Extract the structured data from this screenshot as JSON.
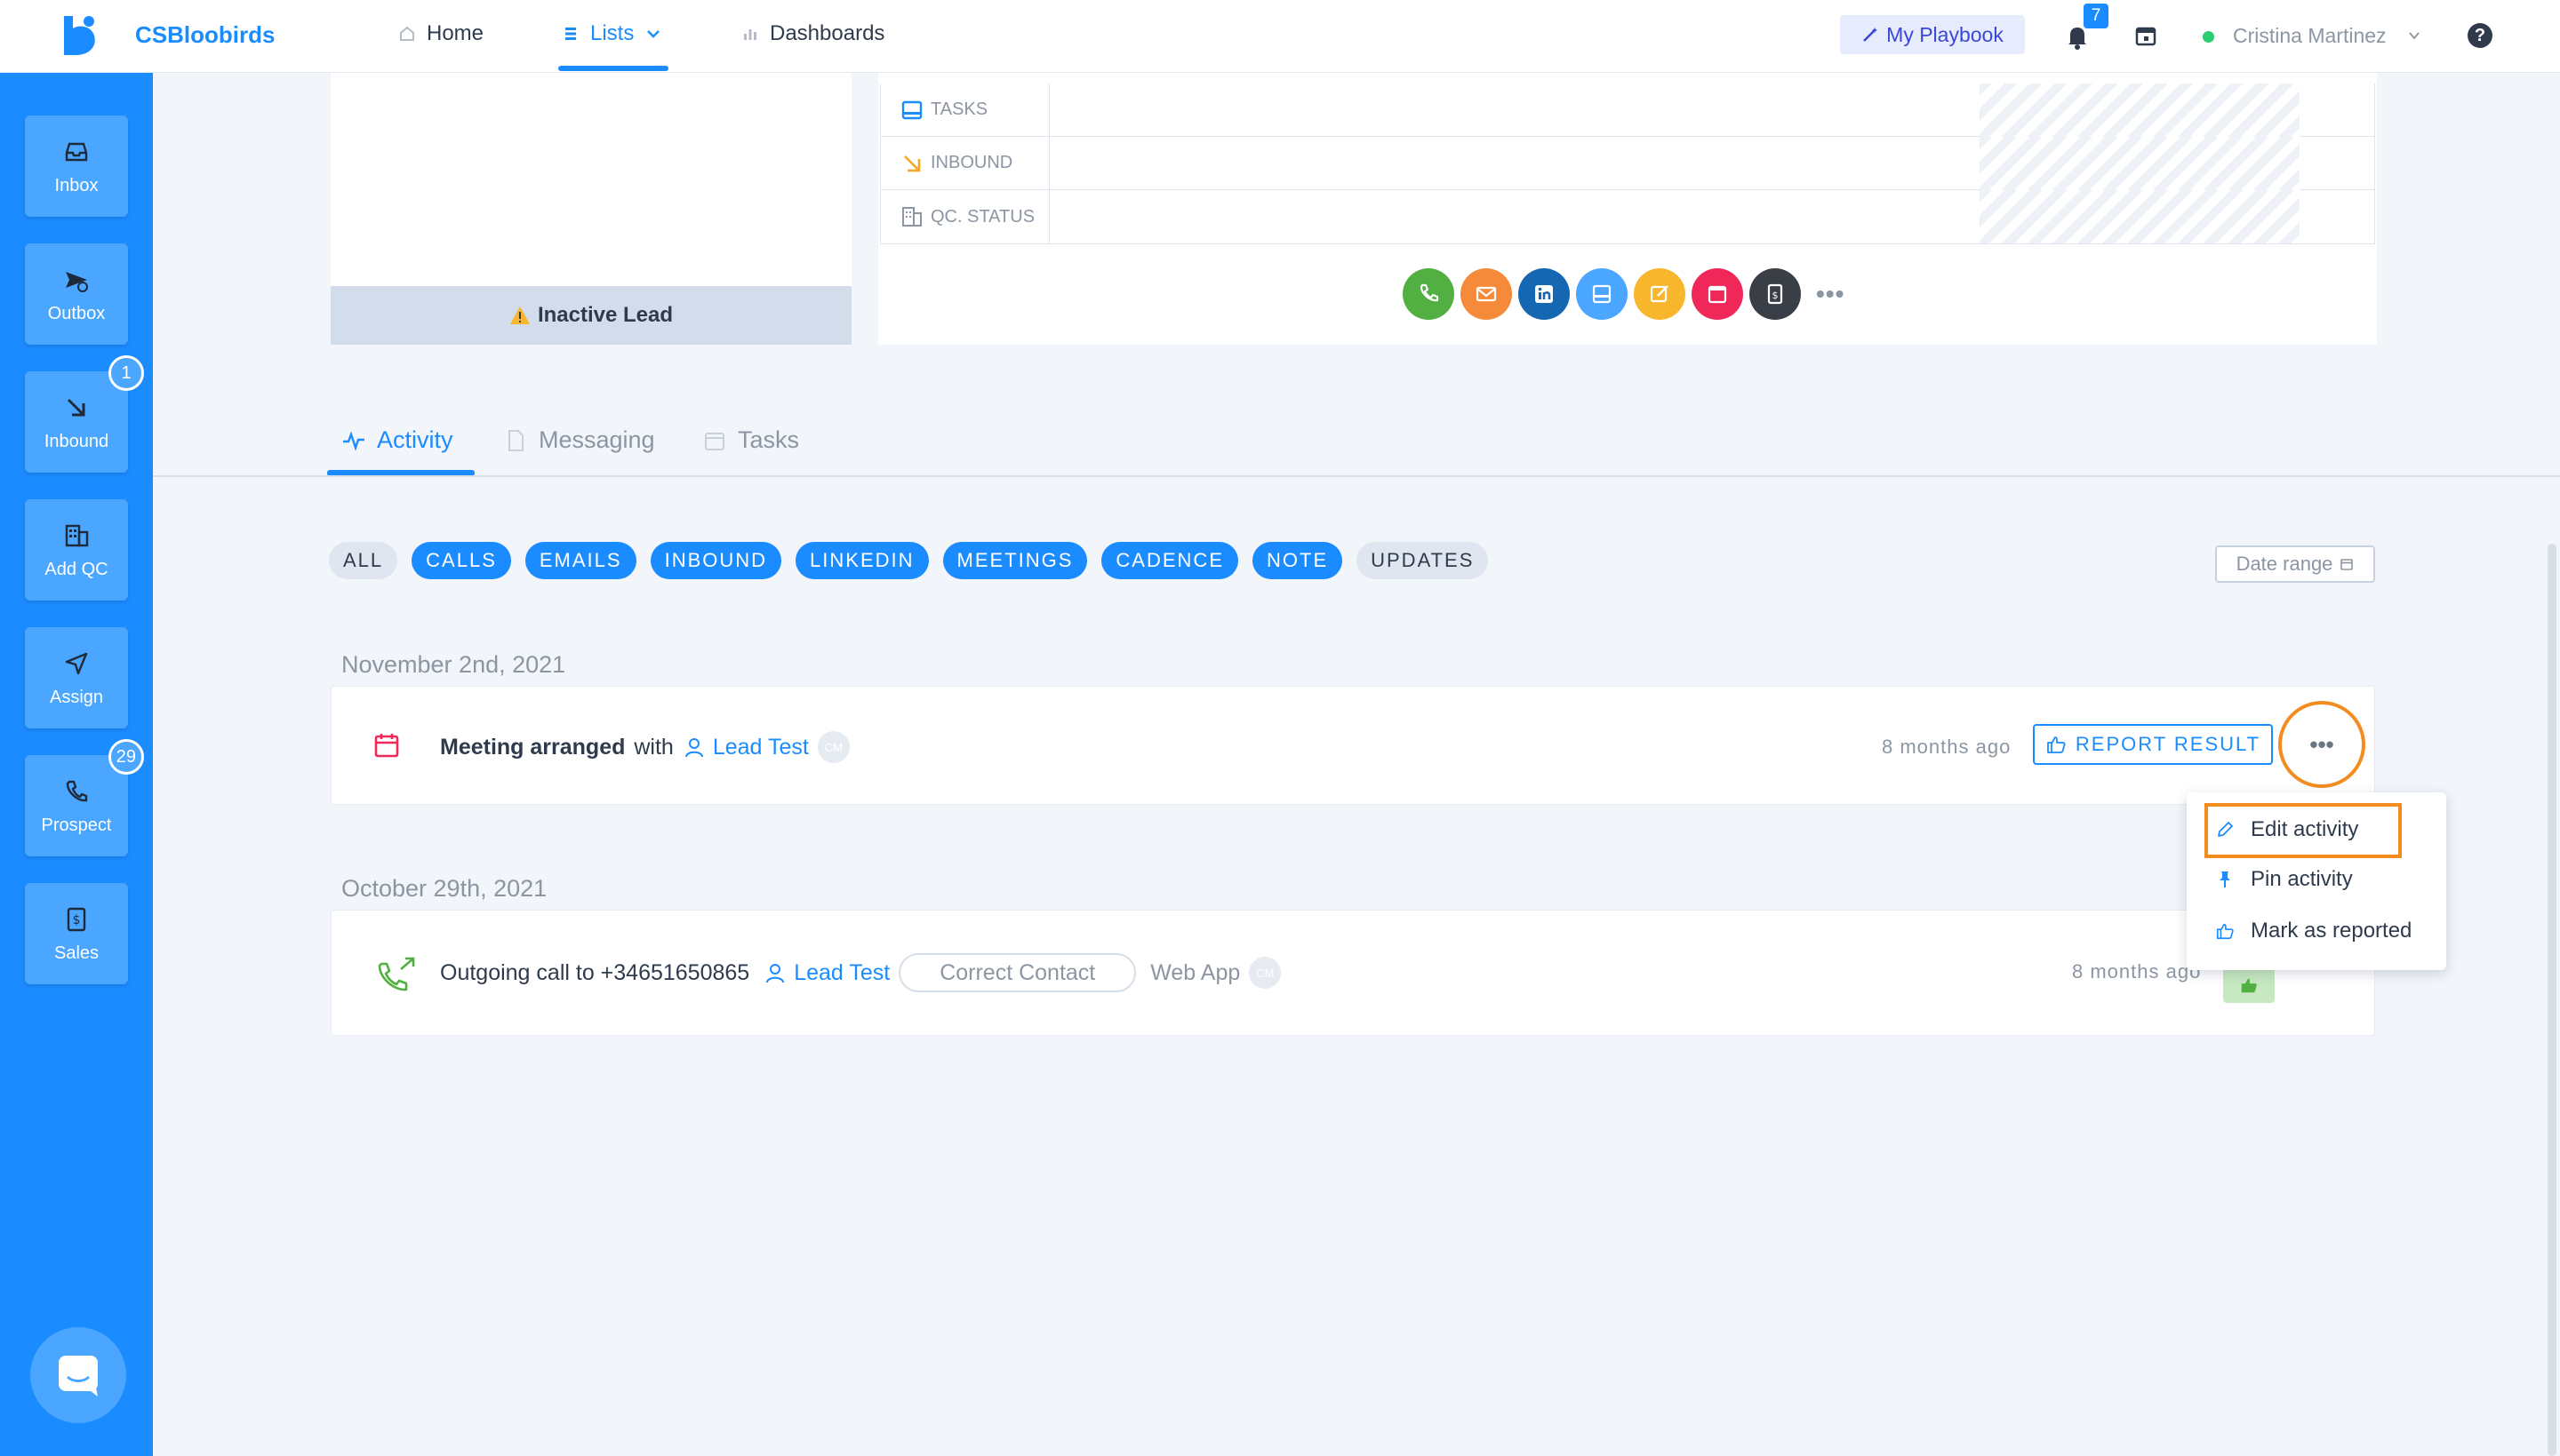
{
  "app": {
    "name": "CSBloobirds"
  },
  "nav": {
    "home": "Home",
    "lists": "Lists",
    "dashboards": "Dashboards"
  },
  "header": {
    "playbook": "My Playbook",
    "notifications_count": "7",
    "user_name": "Cristina Martinez",
    "help": "?"
  },
  "sidebar": {
    "items": [
      {
        "label": "Inbox",
        "badge": ""
      },
      {
        "label": "Outbox",
        "badge": ""
      },
      {
        "label": "Inbound",
        "badge": "1"
      },
      {
        "label": "Add QC",
        "badge": ""
      },
      {
        "label": "Assign",
        "badge": ""
      },
      {
        "label": "Prospect",
        "badge": "29"
      },
      {
        "label": "Sales",
        "badge": ""
      }
    ]
  },
  "lead_card": {
    "status": "Inactive Lead"
  },
  "info_table": {
    "rows": [
      {
        "label": "TASKS"
      },
      {
        "label": "INBOUND"
      },
      {
        "label": "QC. STATUS"
      }
    ]
  },
  "action_icons": [
    {
      "name": "phone-icon",
      "color": "#52b043"
    },
    {
      "name": "mail-icon",
      "color": "#f58b3a"
    },
    {
      "name": "linkedin-icon",
      "color": "#1667b1"
    },
    {
      "name": "inbox-icon",
      "color": "#4aa6ff"
    },
    {
      "name": "note-icon",
      "color": "#f8b62c"
    },
    {
      "name": "calendar-icon",
      "color": "#f0285a"
    },
    {
      "name": "invoice-icon",
      "color": "#3a3f47"
    }
  ],
  "tabs": {
    "activity": "Activity",
    "messaging": "Messaging",
    "tasks": "Tasks"
  },
  "filters": {
    "all": "ALL",
    "calls": "CALLS",
    "emails": "EMAILS",
    "inbound": "INBOUND",
    "linkedin": "LINKEDIN",
    "meetings": "MEETINGS",
    "cadence": "CADENCE",
    "note": "NOTE",
    "updates": "UPDATES",
    "date_range": "Date range"
  },
  "activities": [
    {
      "date": "November 2nd, 2021",
      "title": "Meeting arranged",
      "connector": "with",
      "lead": "Lead Test",
      "avatar": "CM",
      "time_ago": "8 months ago",
      "button": "REPORT RESULT"
    },
    {
      "date": "October 29th, 2021",
      "title": "Outgoing call to +34651650865",
      "lead": "Lead Test",
      "status": "Correct Contact",
      "source": "Web App",
      "avatar": "CM",
      "time_ago": "8 months ago"
    }
  ],
  "menu": {
    "edit": "Edit activity",
    "pin": "Pin activity",
    "report": "Mark as reported"
  },
  "colors": {
    "brand": "#1a8cff",
    "highlight": "#f28c1f"
  }
}
